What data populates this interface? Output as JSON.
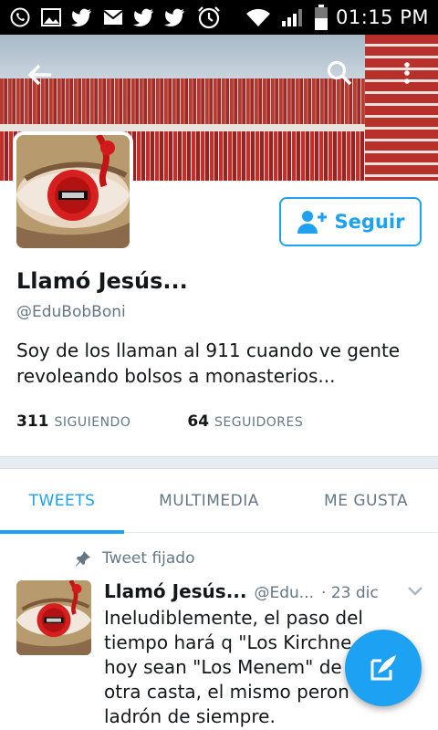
{
  "status_bar": {
    "time": "01:15 PM",
    "left_icons": [
      "whatsapp-icon",
      "image-icon",
      "twitter-icon",
      "email-icon",
      "twitter-icon",
      "twitter-icon",
      "alarm-icon"
    ],
    "right_icons": [
      "wifi-icon",
      "signal-icon",
      "battery-icon"
    ]
  },
  "header": {
    "back_icon": "arrow-left-icon",
    "search_icon": "search-icon",
    "more_icon": "more-vertical-icon"
  },
  "profile": {
    "name": "Llamó Jesús...",
    "handle": "@EduBobBoni",
    "bio": "Soy de los llaman al 911 cuando ve gente revoleando bolsos a monasterios...",
    "following_count": "311",
    "following_label": "SIGUIENDO",
    "followers_count": "64",
    "followers_label": "SEGUIDORES",
    "follow_button_label": "Seguir"
  },
  "tabs": [
    {
      "label": "TWEETS",
      "active": true
    },
    {
      "label": "MULTIMEDIA",
      "active": false
    },
    {
      "label": "ME GUSTA",
      "active": false
    }
  ],
  "pinned_tweet": {
    "pin_label": "Tweet fijado",
    "author_name": "Llamó Jesús...",
    "author_handle": "@Edu...",
    "date": "· 23 dic",
    "lines": [
      "Ineludiblemente, el paso del",
      "tiempo hará q \"Los Kirchner\"",
      "hoy sean \"Los Menem\" de",
      "otra casta, el mismo peronismo",
      "ladrón de siempre."
    ]
  },
  "colors": {
    "accent": "#1da1f2",
    "secondary_text": "#657786"
  }
}
